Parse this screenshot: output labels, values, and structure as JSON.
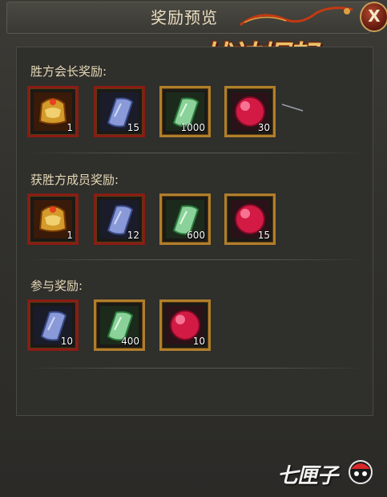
{
  "dialog": {
    "title": "奖励预览",
    "close_label": "X"
  },
  "logo": {
    "text": "战神崛起"
  },
  "sections": [
    {
      "label": "胜方会长奖励:",
      "items": [
        {
          "icon": "golden-helmet-icon",
          "qty": "1",
          "frame": "red"
        },
        {
          "icon": "blue-scroll-icon",
          "qty": "15",
          "frame": "red"
        },
        {
          "icon": "green-scroll-icon",
          "qty": "1000",
          "frame": "gold"
        },
        {
          "icon": "red-orb-icon",
          "qty": "30",
          "frame": "gold"
        }
      ]
    },
    {
      "label": "获胜方成员奖励:",
      "items": [
        {
          "icon": "golden-helmet-icon",
          "qty": "1",
          "frame": "red"
        },
        {
          "icon": "blue-scroll-icon",
          "qty": "12",
          "frame": "red"
        },
        {
          "icon": "green-scroll-icon",
          "qty": "600",
          "frame": "gold"
        },
        {
          "icon": "red-orb-icon",
          "qty": "15",
          "frame": "gold"
        }
      ]
    },
    {
      "label": "参与奖励:",
      "items": [
        {
          "icon": "blue-scroll-icon",
          "qty": "10",
          "frame": "red"
        },
        {
          "icon": "green-scroll-icon",
          "qty": "400",
          "frame": "gold"
        },
        {
          "icon": "red-orb-icon",
          "qty": "10",
          "frame": "gold"
        }
      ]
    }
  ],
  "watermark": {
    "text": "七匣子"
  },
  "colors": {
    "gold_frame": "#b07f2b",
    "red_frame": "#8a1c14",
    "label_text": "#e6d8b6"
  }
}
